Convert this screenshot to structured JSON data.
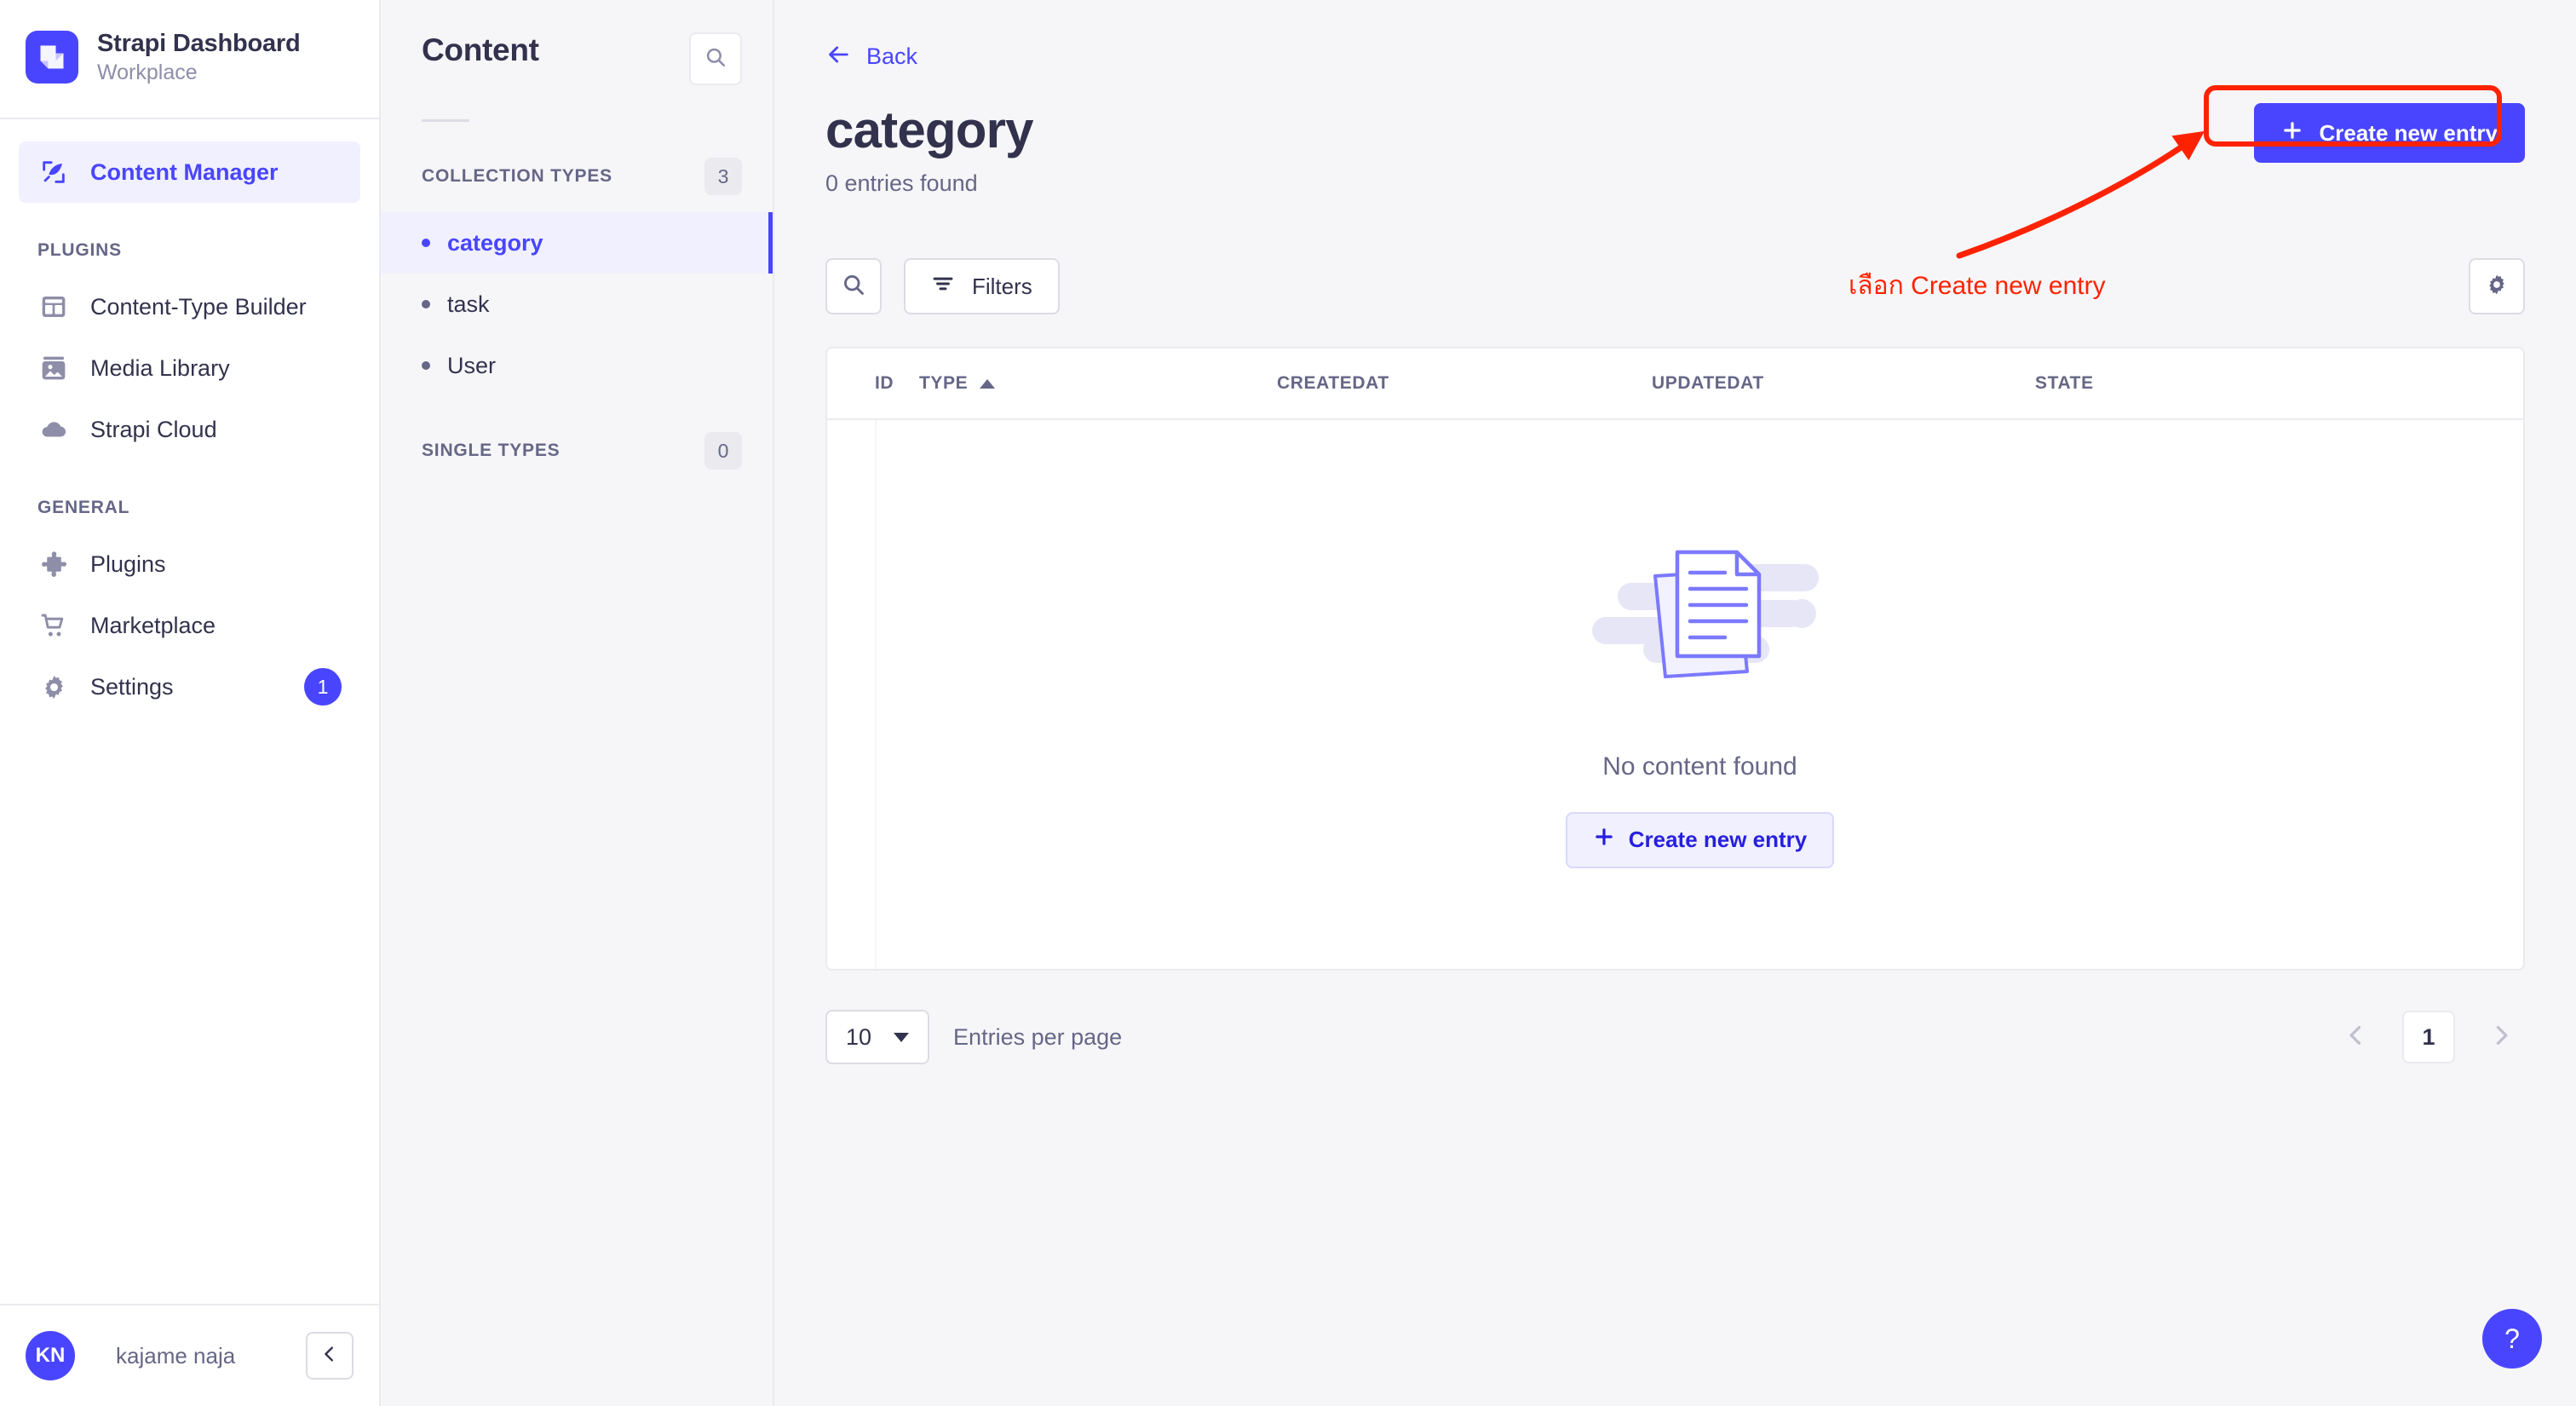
{
  "brand": {
    "title": "Strapi Dashboard",
    "subtitle": "Workplace",
    "logo_icon": "strapi-logo-icon",
    "accent_color": "#4945ff"
  },
  "sidebar": {
    "primary": [
      {
        "label": "Content Manager",
        "icon": "feather-pen-icon",
        "active": true
      }
    ],
    "sections": [
      {
        "label": "PLUGINS",
        "items": [
          {
            "label": "Content-Type Builder",
            "icon": "layout-blocks-icon",
            "badge": null
          },
          {
            "label": "Media Library",
            "icon": "image-icon",
            "badge": null
          },
          {
            "label": "Strapi Cloud",
            "icon": "cloud-icon",
            "badge": null
          }
        ]
      },
      {
        "label": "GENERAL",
        "items": [
          {
            "label": "Plugins",
            "icon": "puzzle-piece-icon",
            "badge": null
          },
          {
            "label": "Marketplace",
            "icon": "shopping-cart-icon",
            "badge": null
          },
          {
            "label": "Settings",
            "icon": "gear-icon",
            "badge": "1"
          }
        ]
      }
    ],
    "footer": {
      "avatar_initials": "KN",
      "user_name": "kajame naja",
      "collapse_icon": "chevron-left-icon"
    }
  },
  "content_panel": {
    "title": "Content",
    "search_icon": "search-icon",
    "collection_types": {
      "label": "COLLECTION TYPES",
      "count": "3",
      "items": [
        {
          "label": "category",
          "active": true
        },
        {
          "label": "task",
          "active": false
        },
        {
          "label": "User",
          "active": false
        }
      ]
    },
    "single_types": {
      "label": "SINGLE TYPES",
      "count": "0",
      "items": []
    }
  },
  "main": {
    "back_label": "Back",
    "back_icon": "arrow-left-icon",
    "page_title": "category",
    "entries_found": "0 entries found",
    "create_button_label": "Create new entry",
    "create_button_icon": "plus-icon",
    "toolbar": {
      "search_icon": "search-icon",
      "filters_label": "Filters",
      "filters_icon": "filter-icon",
      "settings_icon": "gear-icon"
    },
    "table": {
      "columns": [
        {
          "label": "ID",
          "sorted": false
        },
        {
          "label": "TYPE",
          "sorted": true,
          "direction": "asc"
        },
        {
          "label": "CREATEDAT",
          "sorted": false
        },
        {
          "label": "UPDATEDAT",
          "sorted": false
        },
        {
          "label": "STATE",
          "sorted": false
        }
      ],
      "rows": []
    },
    "empty_state": {
      "illustration": "documents-illustration",
      "message": "No content found",
      "action_label": "Create new entry",
      "action_icon": "plus-icon"
    },
    "pagination": {
      "per_page_value": "10",
      "per_page_label": "Entries per page",
      "current_page": "1",
      "prev_icon": "chevron-left-icon",
      "next_icon": "chevron-right-icon"
    },
    "help_button_label": "?"
  },
  "annotations": {
    "highlight_color": "#ff2200",
    "callout_text": "เลือก Create new entry"
  }
}
